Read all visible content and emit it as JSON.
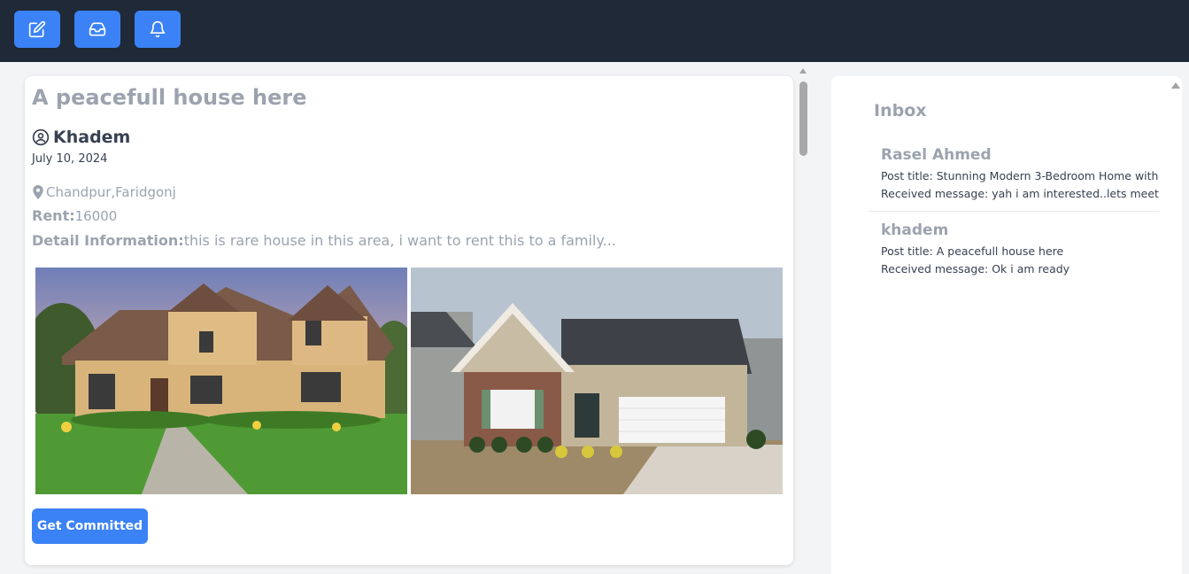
{
  "toolbar": {
    "buttons": [
      {
        "icon": "edit-icon"
      },
      {
        "icon": "inbox-tray-icon"
      },
      {
        "icon": "bell-icon"
      }
    ]
  },
  "post": {
    "title": "A peacefull house here",
    "author": "Khadem",
    "date": "July 10, 2024",
    "location": "Chandpur,Faridgonj",
    "rent_label": "Rent:",
    "rent_value": "16000",
    "detail_label": "Detail Information:",
    "detail_value": "this is rare house in this area, i want to rent this to a family...",
    "button_label": "Get Committed"
  },
  "inbox": {
    "title": "Inbox",
    "messages": [
      {
        "sender": "Rasel Ahmed",
        "post_title": "Post title: Stunning Modern 3-Bedroom Home with",
        "received": "Received message: yah i am interested..lets meet"
      },
      {
        "sender": "khadem",
        "post_title": "Post title: A peacefull house here",
        "received": "Received message: Ok i am ready"
      }
    ]
  },
  "colors": {
    "topbar": "#1f2937",
    "accent": "#3b82f6",
    "muted_text": "#9ca3af",
    "body_text": "#374151"
  }
}
